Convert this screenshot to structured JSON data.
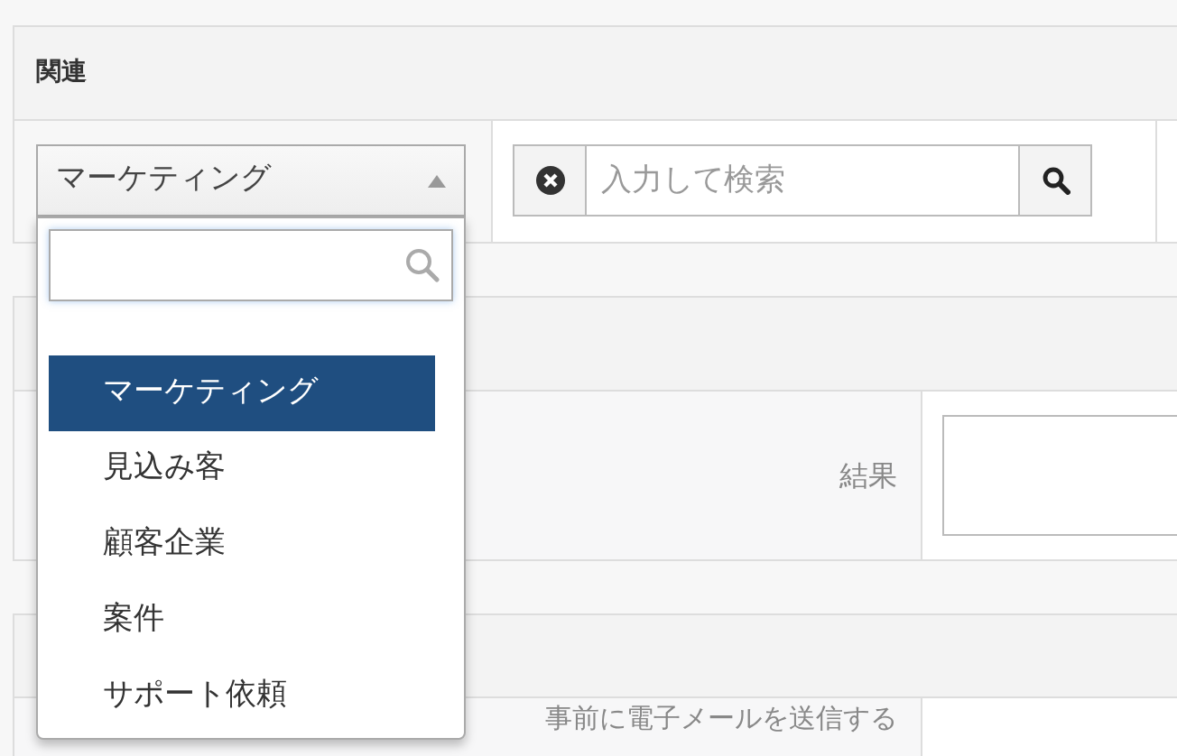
{
  "related": {
    "title": "関連",
    "select": {
      "value": "マーケティング",
      "open": true
    },
    "search": {
      "placeholder": "入力して検索"
    }
  },
  "dropdown": {
    "options": [
      {
        "label": "マーケティング",
        "selected": true
      },
      {
        "label": "見込み客",
        "selected": false
      },
      {
        "label": "顧客企業",
        "selected": false
      },
      {
        "label": "案件",
        "selected": false
      },
      {
        "label": "サポート依頼",
        "selected": false
      }
    ]
  },
  "result": {
    "label": "結果"
  },
  "email": {
    "label": "事前に電子メールを送信する"
  }
}
